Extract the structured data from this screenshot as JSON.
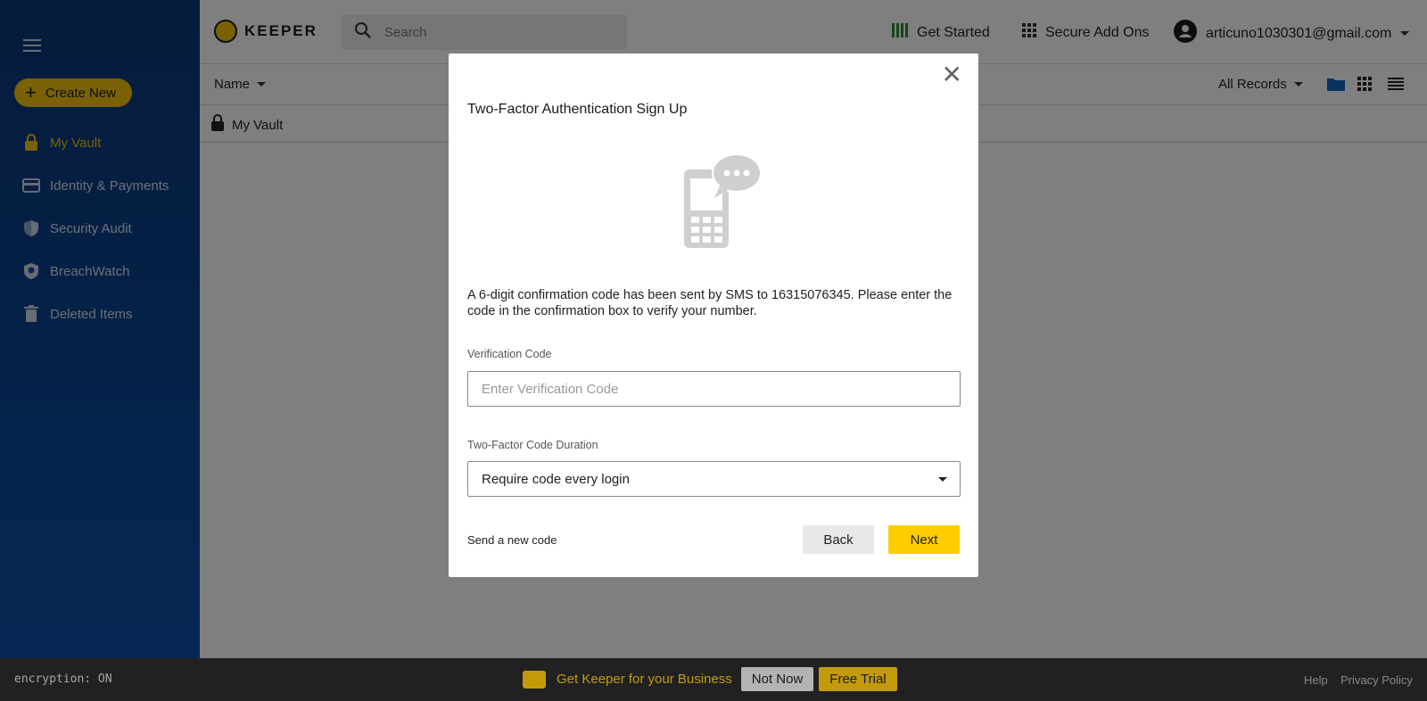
{
  "sidebar": {
    "create_label": "Create New",
    "items": [
      {
        "label": "My Vault",
        "icon": "lock-icon"
      },
      {
        "label": "Identity & Payments",
        "icon": "credit-card-icon"
      },
      {
        "label": "Security Audit",
        "icon": "shield-icon"
      },
      {
        "label": "BreachWatch",
        "icon": "breachwatch-icon"
      },
      {
        "label": "Deleted Items",
        "icon": "trash-icon"
      }
    ]
  },
  "topbar": {
    "logo": "KEEPER",
    "search_placeholder": "Search",
    "get_started": "Get Started",
    "secure_addons": "Secure Add Ons",
    "account": "articuno1030301@gmail.com"
  },
  "subbar": {
    "sort_label": "Name",
    "filter_label": "All Records"
  },
  "breadcrumb": {
    "label": "My Vault"
  },
  "footer": {
    "encryption": "encryption: ON",
    "promo": "Get Keeper for your Business",
    "not_now": "Not Now",
    "free_trial": "Free Trial",
    "help": "Help",
    "privacy": "Privacy Policy"
  },
  "modal": {
    "title": "Two-Factor Authentication Sign Up",
    "message": "A 6-digit confirmation code has been sent by SMS to 16315076345. Please enter the code in the confirmation box to verify your number.",
    "code_label": "Verification Code",
    "code_placeholder": "Enter Verification Code",
    "duration_label": "Two-Factor Code Duration",
    "duration_value": "Require code every login",
    "send_new": "Send a new code",
    "back": "Back",
    "next": "Next"
  },
  "colors": {
    "accent": "#f4c20d",
    "sidebar": "#0a3777"
  }
}
